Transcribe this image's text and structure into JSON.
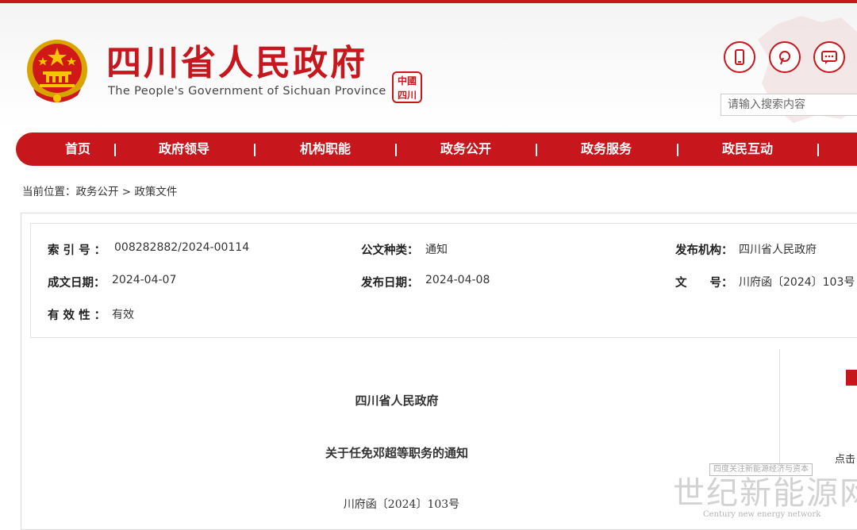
{
  "colors": {
    "brand_red": "#c8161d",
    "gold": "#f7c600"
  },
  "header": {
    "title": "四川省人民政府",
    "subtitle": "The People's Government of Sichuan Province",
    "seal_chars": [
      "中",
      "國",
      "四",
      "川"
    ],
    "tools": [
      {
        "icon": "mobile-icon"
      },
      {
        "icon": "weibo-icon"
      },
      {
        "icon": "message-icon"
      }
    ],
    "search": {
      "placeholder": "请输入搜索内容"
    }
  },
  "nav": {
    "items": [
      "首页",
      "政府领导",
      "机构职能",
      "政务公开",
      "政务服务",
      "政民互动"
    ]
  },
  "breadcrumb": {
    "prefix": "当前位置：",
    "crumbs": [
      "政务公开",
      "政策文件"
    ],
    "separator": ">"
  },
  "meta": {
    "index_label": "索 引 号 ：",
    "index_value": "008282882/2024-00114",
    "type_label": "公文种类：",
    "type_value": "通知",
    "org_label": "发布机构：",
    "org_value": "四川省人民政府",
    "written_label": "成文日期：",
    "written_value": "2024-04-07",
    "publish_label": "发布日期：",
    "publish_value": "2024-04-08",
    "docno_label": "文　　号：",
    "docno_value": "川府函〔2024〕103号",
    "valid_label": "有 效 性 ：",
    "valid_value": "有效"
  },
  "document": {
    "issuer": "四川省人民政府",
    "title": "关于任免邓超等职务的通知",
    "number": "川府函〔2024〕103号"
  },
  "side": {
    "click_text": "点击"
  },
  "watermark": {
    "tag": "四度关注新能源经济与资本",
    "main": "世纪新能源网",
    "sub": "Century new energy network"
  }
}
